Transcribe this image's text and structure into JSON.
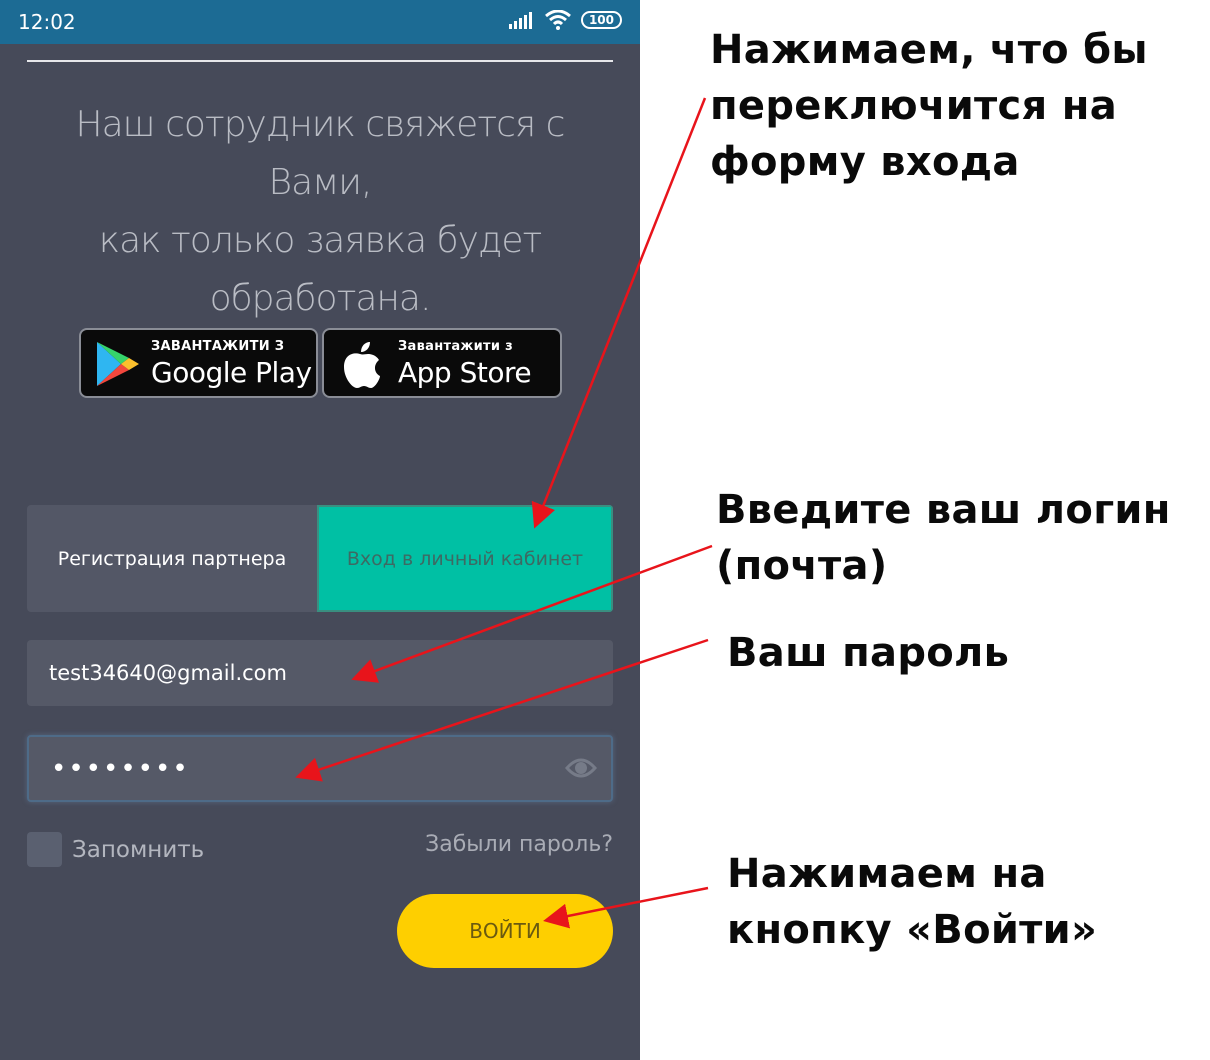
{
  "status_bar": {
    "time": "12:02",
    "battery": "100",
    "icons": [
      "signal-icon",
      "wifi-icon",
      "battery-icon"
    ]
  },
  "info_text": [
    "Наш сотрудник свяжется с Вами,",
    "как только заявка будет",
    "обработана."
  ],
  "store_badges": {
    "google": {
      "small": "ЗАВАНТАЖИТИ З",
      "big": "Google Play"
    },
    "apple": {
      "small": "Завантажити з",
      "big": "App Store"
    }
  },
  "tabs": {
    "register": "Регистрация партнера",
    "login": "Вход в личный кабинет",
    "active": "login"
  },
  "form": {
    "email": "test34640@gmail.com",
    "password_masked": "••••••••",
    "remember_label": "Запомнить",
    "remember_checked": false,
    "forgot_link": "Забыли пароль?",
    "submit": "ВОЙТИ"
  },
  "annotations": {
    "switch_to_login": "Нажимаем, что бы переключится на форму входа",
    "enter_login": "Введите ваш логин (почта)",
    "password": "Ваш пароль",
    "press_login": "Нажимаем на кнопку «Войти»"
  },
  "colors": {
    "background": "#464a59",
    "status_bar": "#1c6b94",
    "active_tab": "#00c0a4",
    "inactive_tab": "#535766",
    "input": "#555967",
    "button": "#fecf00",
    "arrow": "#e8141b"
  }
}
